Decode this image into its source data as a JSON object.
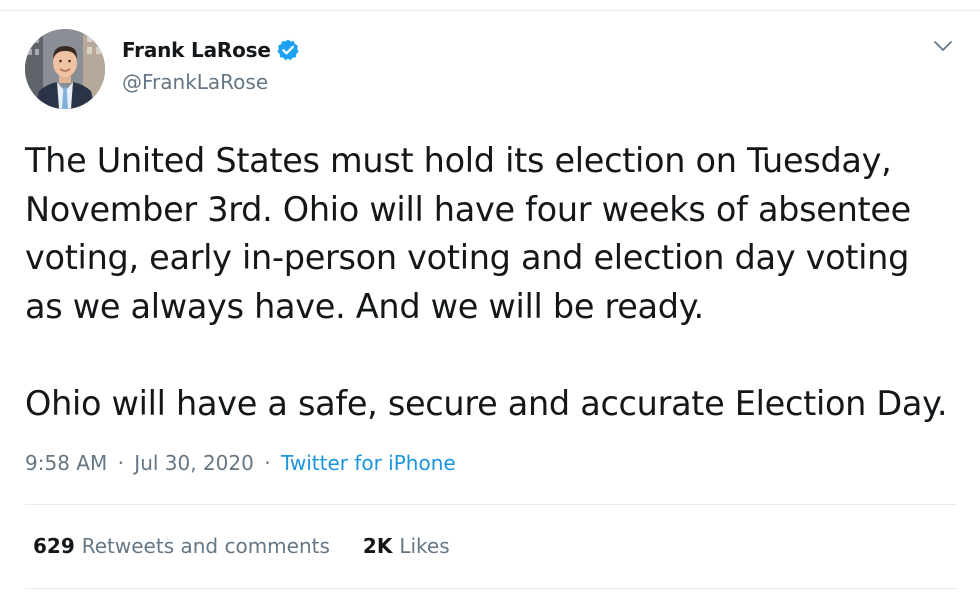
{
  "author": {
    "display_name": "Frank LaRose",
    "handle": "@FrankLaRose",
    "verified": true,
    "avatar_icon": "profile-photo"
  },
  "tweet": {
    "text": "The United States must hold its election on Tuesday,\nNovember 3rd. Ohio will have four weeks of absentee\nvoting, early in-person voting and election day voting\nas we always have. And we will be ready.\n\nOhio will have a safe, secure and accurate Election Day.",
    "time": "9:58 AM",
    "separator": "·",
    "date": "Jul 30, 2020",
    "source": "Twitter for iPhone"
  },
  "stats": {
    "retweets_count": "629",
    "retweets_label": "Retweets and comments",
    "likes_count": "2K",
    "likes_label": "Likes"
  },
  "colors": {
    "text": "#14171a",
    "secondary": "#657786",
    "link": "#1b95e0",
    "verified": "#1da1f2",
    "divider": "#e6ecf0"
  },
  "icons": {
    "verified": "verified-badge-icon",
    "menu": "chevron-down-icon"
  }
}
